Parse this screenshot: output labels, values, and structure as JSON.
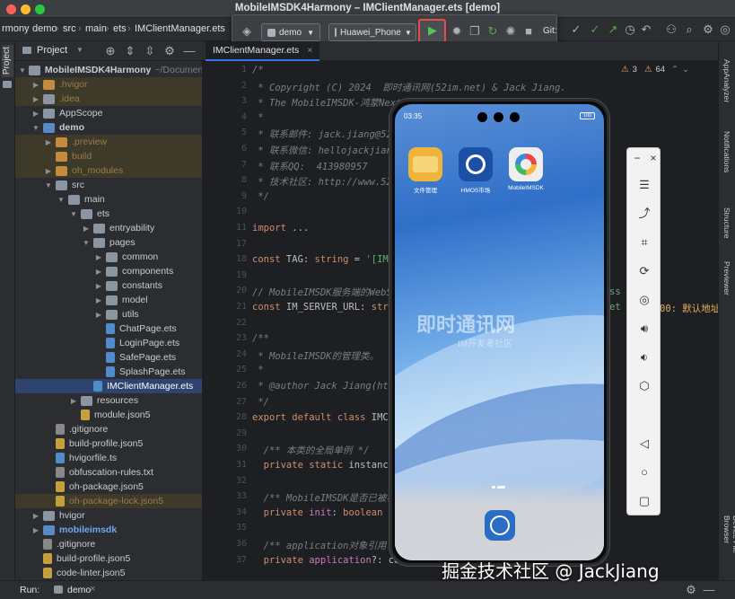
{
  "window": {
    "title": "MobileIMSDK4Harmony – IMClientManager.ets [demo]"
  },
  "breadcrumb": [
    "rmony",
    "demo",
    "src",
    "main",
    "ets",
    "IMClientManager.ets"
  ],
  "run": {
    "config": "demo",
    "device": "Huawei_Phone",
    "git_label": "Git:"
  },
  "project": {
    "title": "Project",
    "strip_label": "Project",
    "tree": [
      {
        "indent": 0,
        "arrow": "down",
        "icon": "dir",
        "label": "MobileIMSDK4Harmony",
        "suffix": "~/Documen",
        "bold": true
      },
      {
        "indent": 1,
        "arrow": "right",
        "icon": "dirorange",
        "label": ".hvigor",
        "style": "dim"
      },
      {
        "indent": 1,
        "arrow": "right",
        "icon": "dir",
        "label": ".idea",
        "style": "dim"
      },
      {
        "indent": 1,
        "arrow": "right",
        "icon": "dir",
        "label": "AppScope"
      },
      {
        "indent": 1,
        "arrow": "down",
        "icon": "dirblue",
        "label": "demo",
        "bold": true
      },
      {
        "indent": 2,
        "arrow": "right",
        "icon": "dirorange",
        "label": ".preview",
        "style": "dim"
      },
      {
        "indent": 2,
        "arrow": "",
        "icon": "dirorange",
        "label": "build",
        "style": "dim"
      },
      {
        "indent": 2,
        "arrow": "right",
        "icon": "dirorange",
        "label": "oh_modules",
        "style": "dim"
      },
      {
        "indent": 2,
        "arrow": "down",
        "icon": "dir",
        "label": "src"
      },
      {
        "indent": 3,
        "arrow": "down",
        "icon": "dir",
        "label": "main"
      },
      {
        "indent": 4,
        "arrow": "down",
        "icon": "dir",
        "label": "ets"
      },
      {
        "indent": 5,
        "arrow": "right",
        "icon": "dir",
        "label": "entryability"
      },
      {
        "indent": 5,
        "arrow": "down",
        "icon": "dir",
        "label": "pages"
      },
      {
        "indent": 6,
        "arrow": "right",
        "icon": "dir",
        "label": "common"
      },
      {
        "indent": 6,
        "arrow": "right",
        "icon": "dir",
        "label": "components"
      },
      {
        "indent": 6,
        "arrow": "right",
        "icon": "dir",
        "label": "constants"
      },
      {
        "indent": 6,
        "arrow": "right",
        "icon": "dir",
        "label": "model"
      },
      {
        "indent": 6,
        "arrow": "right",
        "icon": "dir",
        "label": "utils"
      },
      {
        "indent": 6,
        "arrow": "",
        "icon": "ets",
        "label": "ChatPage.ets"
      },
      {
        "indent": 6,
        "arrow": "",
        "icon": "ets",
        "label": "LoginPage.ets"
      },
      {
        "indent": 6,
        "arrow": "",
        "icon": "ets",
        "label": "SafePage.ets"
      },
      {
        "indent": 6,
        "arrow": "",
        "icon": "ets",
        "label": "SplashPage.ets"
      },
      {
        "indent": 5,
        "arrow": "",
        "icon": "ets",
        "label": "IMClientManager.ets",
        "selected": true
      },
      {
        "indent": 4,
        "arrow": "right",
        "icon": "dir",
        "label": "resources"
      },
      {
        "indent": 4,
        "arrow": "",
        "icon": "json",
        "label": "module.json5"
      },
      {
        "indent": 2,
        "arrow": "",
        "icon": "txt",
        "label": ".gitignore"
      },
      {
        "indent": 2,
        "arrow": "",
        "icon": "json",
        "label": "build-profile.json5"
      },
      {
        "indent": 2,
        "arrow": "",
        "icon": "ets",
        "label": "hvigorfile.ts"
      },
      {
        "indent": 2,
        "arrow": "",
        "icon": "txt",
        "label": "obfuscation-rules.txt"
      },
      {
        "indent": 2,
        "arrow": "",
        "icon": "json",
        "label": "oh-package.json5"
      },
      {
        "indent": 2,
        "arrow": "",
        "icon": "json",
        "label": "oh-package-lock.json5",
        "style": "dim"
      },
      {
        "indent": 1,
        "arrow": "right",
        "icon": "dir",
        "label": "hvigor"
      },
      {
        "indent": 1,
        "arrow": "right",
        "icon": "dirblue",
        "label": "mobileimsdk",
        "bold": true
      },
      {
        "indent": 1,
        "arrow": "",
        "icon": "txt",
        "label": ".gitignore"
      },
      {
        "indent": 1,
        "arrow": "",
        "icon": "json",
        "label": "build-profile.json5"
      },
      {
        "indent": 1,
        "arrow": "",
        "icon": "json",
        "label": "code-linter.json5"
      }
    ]
  },
  "editor": {
    "tab": "IMClientManager.ets",
    "warnings": "3",
    "weak_warnings": "64",
    "lines": [
      {
        "n": "1",
        "segs": [
          [
            "c-com",
            "/*"
          ]
        ]
      },
      {
        "n": "2",
        "segs": [
          [
            "c-com",
            " * Copyright (C) 2024  即时通讯网(52im.net) & Jack Jiang."
          ]
        ]
      },
      {
        "n": "3",
        "segs": [
          [
            "c-com",
            " * The MobileIMSDK-鸿蒙Next客户端"
          ]
        ]
      },
      {
        "n": "4",
        "segs": [
          [
            "c-com",
            " *"
          ]
        ]
      },
      {
        "n": "5",
        "segs": [
          [
            "c-com",
            " * 联系邮件: jack.jiang@52"
          ]
        ]
      },
      {
        "n": "6",
        "segs": [
          [
            "c-com",
            " * 联系微信: hellojackjiang"
          ]
        ]
      },
      {
        "n": "7",
        "segs": [
          [
            "c-com",
            " * 联系QQ:  413980957"
          ]
        ]
      },
      {
        "n": "8",
        "segs": [
          [
            "c-com",
            " * 技术社区: http://www.52"
          ]
        ]
      },
      {
        "n": "9",
        "segs": [
          [
            "c-com",
            " */"
          ]
        ]
      },
      {
        "n": "10",
        "segs": []
      },
      {
        "n": "11",
        "segs": [
          [
            "c-kw",
            "import"
          ],
          [
            "",
            " ..."
          ]
        ]
      },
      {
        "n": "17",
        "segs": []
      },
      {
        "n": "18",
        "segs": [
          [
            "c-kw",
            "const"
          ],
          [
            "",
            " TAG: "
          ],
          [
            "c-kw",
            "string"
          ],
          [
            "",
            " = "
          ],
          [
            "c-str",
            "'[IMC"
          ]
        ]
      },
      {
        "n": "19",
        "segs": []
      },
      {
        "n": "20",
        "segs": [
          [
            "c-com",
            "// MobileIMSDK服务端的WebS"
          ]
        ]
      },
      {
        "n": "21",
        "segs": [
          [
            "c-kw",
            "const"
          ],
          [
            "",
            " IM_SERVER_URL: "
          ],
          [
            "c-kw",
            "stri"
          ]
        ]
      },
      {
        "n": "22",
        "segs": []
      },
      {
        "n": "23",
        "segs": [
          [
            "c-com",
            "/**"
          ]
        ]
      },
      {
        "n": "24",
        "segs": [
          [
            "c-com",
            " * MobileIMSDK的管理类。"
          ]
        ]
      },
      {
        "n": "25",
        "segs": [
          [
            "c-com",
            " *"
          ]
        ]
      },
      {
        "n": "26",
        "segs": [
          [
            "c-com",
            " * @author Jack Jiang(htt"
          ]
        ]
      },
      {
        "n": "27",
        "segs": [
          [
            "c-com",
            " */"
          ]
        ]
      },
      {
        "n": "28",
        "segs": [
          [
            "c-kw",
            "export default class"
          ],
          [
            "",
            " IMCl"
          ]
        ]
      },
      {
        "n": "29",
        "segs": []
      },
      {
        "n": "30",
        "segs": [
          [
            "c-com",
            "  /** 本类的全局单例 */"
          ]
        ]
      },
      {
        "n": "31",
        "segs": [
          [
            "c-kw",
            "  private static"
          ],
          [
            "",
            " instance"
          ]
        ]
      },
      {
        "n": "32",
        "segs": []
      },
      {
        "n": "33",
        "segs": [
          [
            "c-com",
            "  /** MobileIMSDK是否已被初"
          ]
        ]
      },
      {
        "n": "34",
        "segs": [
          [
            "c-kw",
            "  private"
          ],
          [
            "c-fld",
            " init"
          ],
          [
            "",
            ": "
          ],
          [
            "c-kw",
            "boolean"
          ],
          [
            "",
            " ="
          ]
        ]
      },
      {
        "n": "35",
        "segs": []
      },
      {
        "n": "36",
        "segs": [
          [
            "c-com",
            "  /** application对象引用"
          ]
        ]
      },
      {
        "n": "37",
        "segs": [
          [
            "c-kw",
            "  private"
          ],
          [
            "c-fld",
            " application"
          ],
          [
            "",
            "?: co"
          ]
        ]
      }
    ],
    "overflow_text": [
      "ss",
      "et",
      "00: 默认地址"
    ]
  },
  "phone": {
    "time": "03:35",
    "battery": "100",
    "apps": [
      {
        "label": "文件管理",
        "color": "#f0b43a"
      },
      {
        "label": "HMOS市场",
        "color": "#1c4fa6"
      },
      {
        "label": "MobileIMSDK",
        "color": "#eeeeee"
      }
    ],
    "wallpaper_text": "即时通讯网",
    "wallpaper_sub": "IM开发者社区"
  },
  "right_strip": [
    "AppAnalyzer",
    "Notifications",
    "Structure",
    "Previewer",
    "Device File Browser"
  ],
  "bottom": {
    "run_label": "Run:",
    "run_target": "demo"
  },
  "watermark": "掘金技术社区 @ JackJiang"
}
